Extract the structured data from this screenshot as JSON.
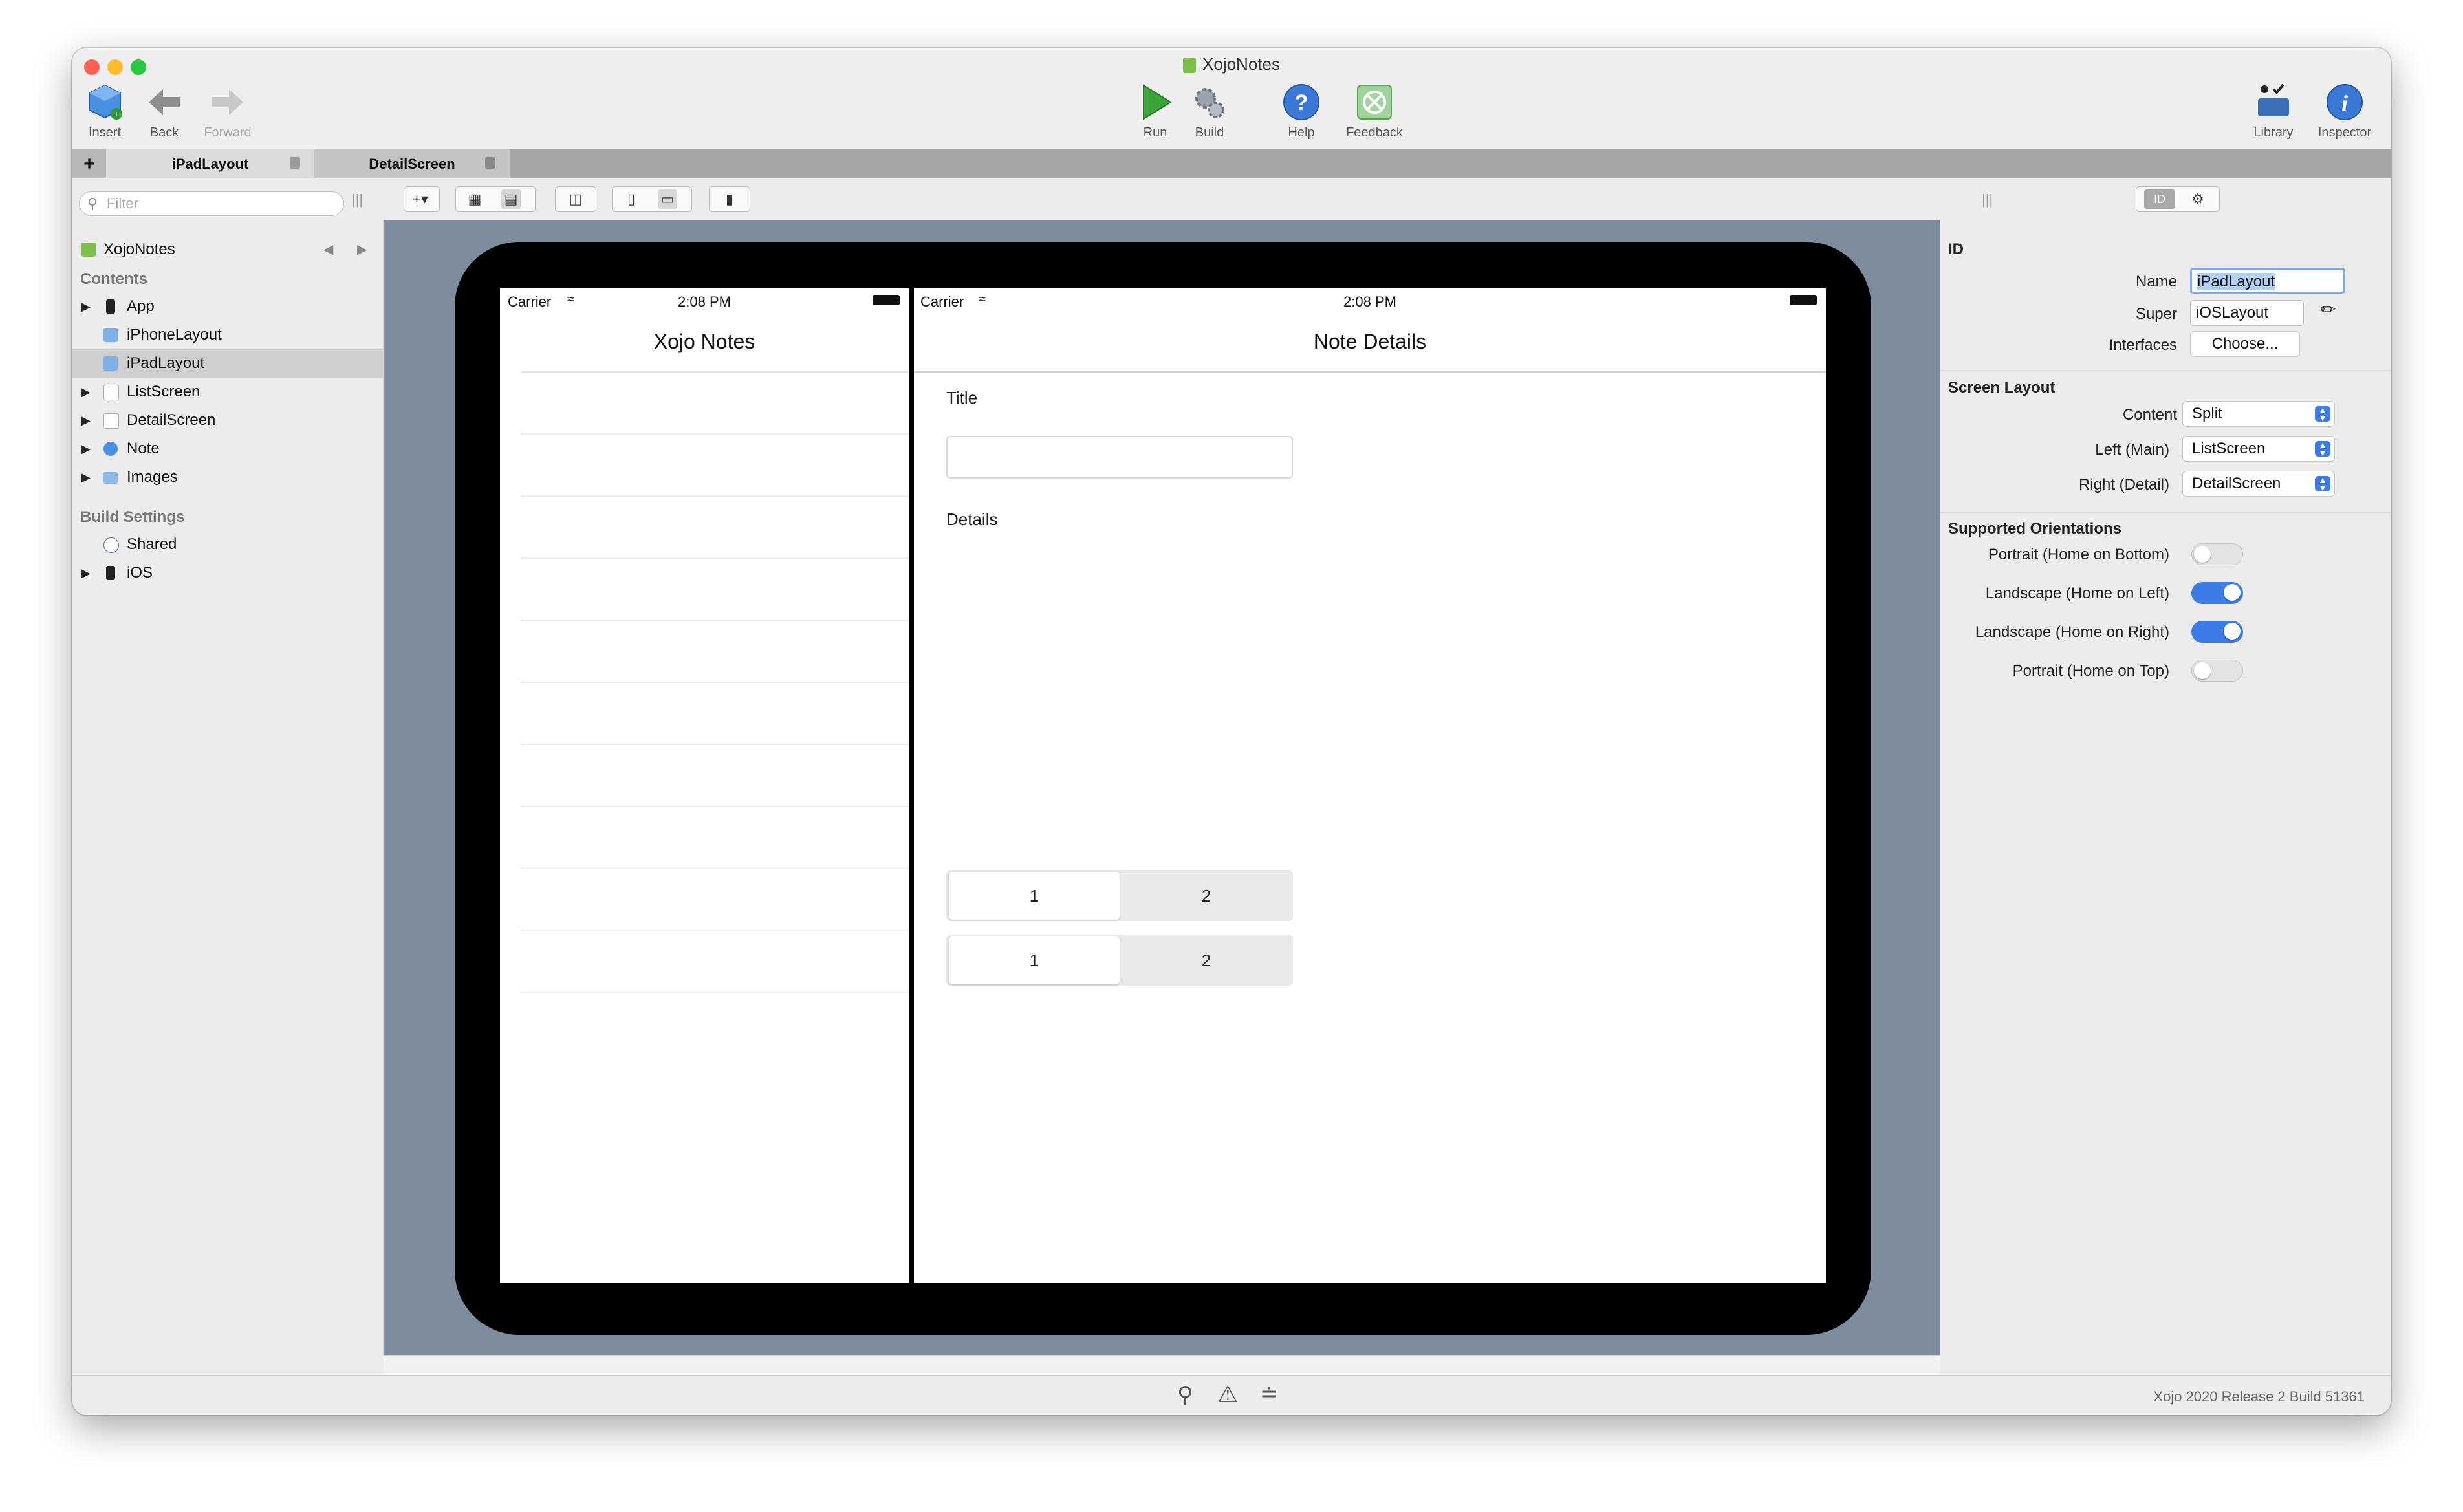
{
  "window": {
    "title": "XojoNotes"
  },
  "toolbar": {
    "insert": "Insert",
    "back": "Back",
    "forward": "Forward",
    "run": "Run",
    "build": "Build",
    "help": "Help",
    "feedback": "Feedback",
    "library": "Library",
    "library_badge": "OK",
    "inspector": "Inspector"
  },
  "tabs": [
    {
      "label": "iPadLayout",
      "active": true
    },
    {
      "label": "DetailScreen",
      "active": false
    }
  ],
  "sidebar": {
    "filter_placeholder": "Filter",
    "project": "XojoNotes",
    "contents_heading": "Contents",
    "items": [
      {
        "label": "App",
        "icon": "app-icon"
      },
      {
        "label": "iPhoneLayout",
        "icon": "layout-icon"
      },
      {
        "label": "iPadLayout",
        "icon": "layout-icon",
        "selected": true
      },
      {
        "label": "ListScreen",
        "icon": "screen-icon"
      },
      {
        "label": "DetailScreen",
        "icon": "screen-icon"
      },
      {
        "label": "Note",
        "icon": "class-icon"
      },
      {
        "label": "Images",
        "icon": "folder-icon"
      }
    ],
    "build_heading": "Build Settings",
    "build_items": [
      {
        "label": "Shared",
        "icon": "shared-icon"
      },
      {
        "label": "iOS",
        "icon": "ios-icon"
      }
    ]
  },
  "preview": {
    "left": {
      "carrier": "Carrier",
      "time": "2:08 PM",
      "title": "Xojo Notes"
    },
    "right": {
      "carrier": "Carrier",
      "time": "2:08 PM",
      "title": "Note Details",
      "title_label": "Title",
      "details_label": "Details",
      "segments": [
        [
          "1",
          "2"
        ],
        [
          "1",
          "2"
        ]
      ]
    }
  },
  "inspector": {
    "id_heading": "ID",
    "name_label": "Name",
    "name_value": "iPadLayout",
    "super_label": "Super",
    "super_value": "iOSLayout",
    "interfaces_label": "Interfaces",
    "interfaces_button": "Choose...",
    "screen_layout_heading": "Screen Layout",
    "content_label": "Content",
    "content_value": "Split",
    "left_label": "Left (Main)",
    "left_value": "ListScreen",
    "right_label": "Right (Detail)",
    "right_value": "DetailScreen",
    "orientations_heading": "Supported Orientations",
    "orientations": [
      {
        "label": "Portrait (Home on Bottom)",
        "on": false
      },
      {
        "label": "Landscape (Home on Left)",
        "on": true
      },
      {
        "label": "Landscape (Home on Right)",
        "on": true
      },
      {
        "label": "Portrait (Home on Top)",
        "on": false
      }
    ]
  },
  "statusbar": {
    "version": "Xojo 2020 Release 2 Build 51361"
  },
  "colors": {
    "accent": "#3d7ce6",
    "canvas": "#7e8d9d",
    "selection": "#cfcfcf"
  }
}
